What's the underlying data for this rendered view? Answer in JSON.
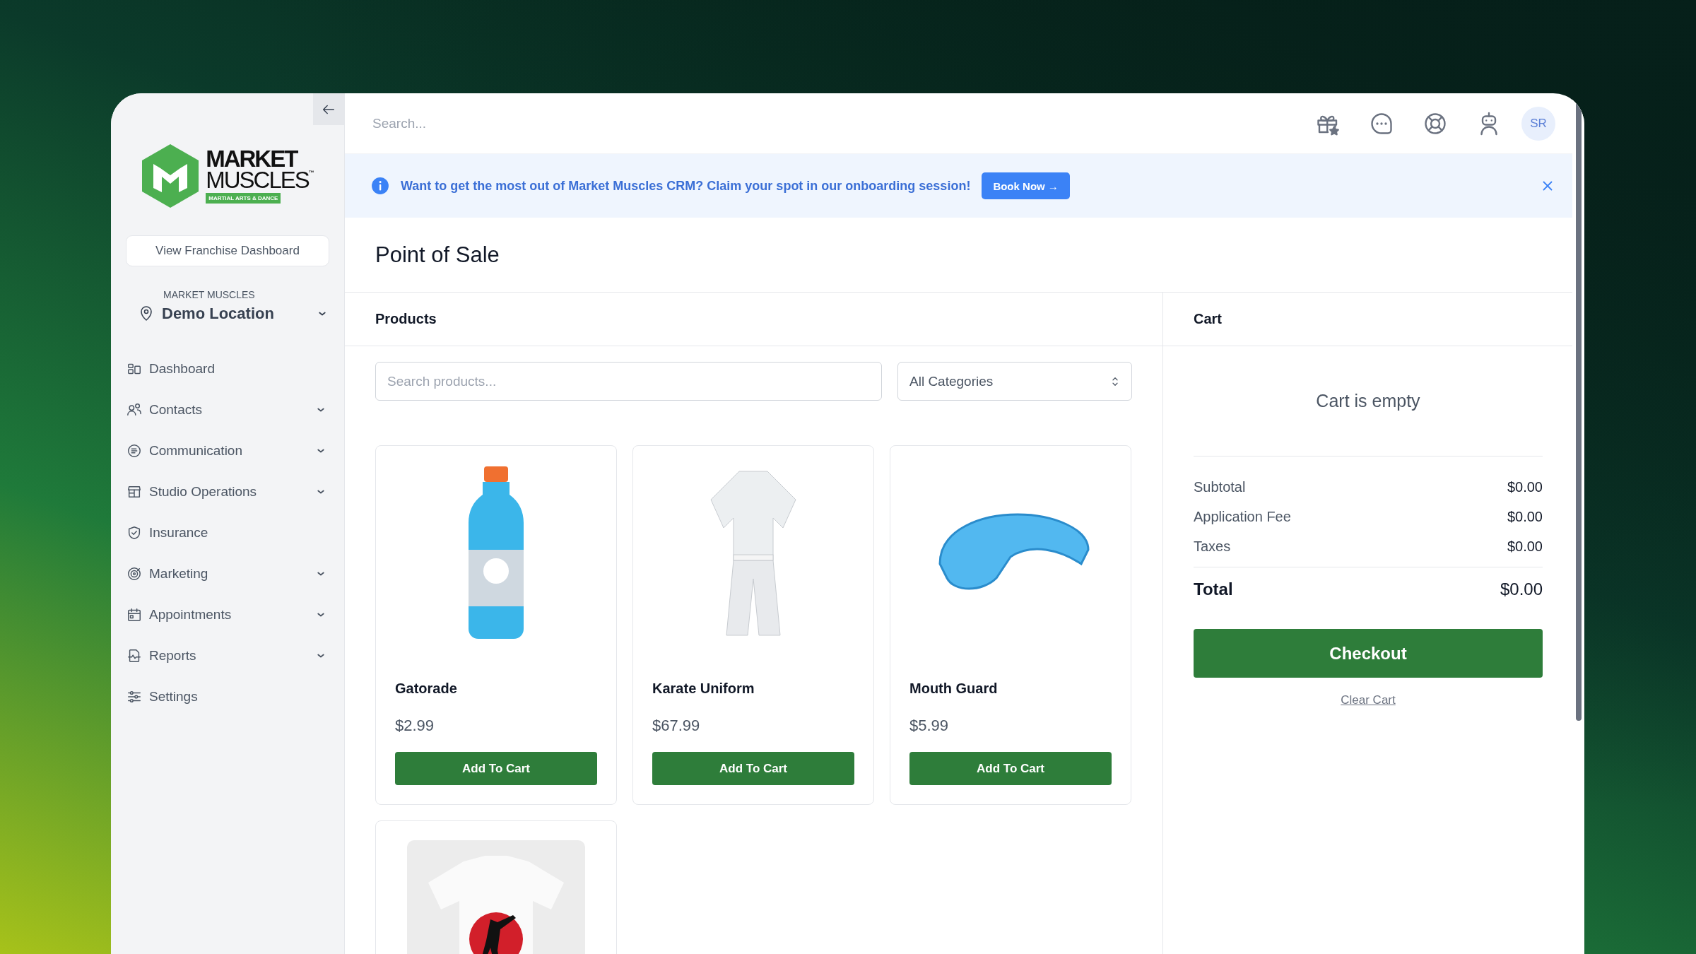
{
  "sidebar": {
    "logo": {
      "line_1": "MARKET",
      "line_2": "MUSCLES",
      "trademark": "™",
      "tagline": "MARTIAL ARTS & DANCE"
    },
    "franchise_button": "View Franchise Dashboard",
    "location": {
      "label": "MARKET MUSCLES",
      "name": "Demo Location"
    },
    "items": [
      {
        "label": "Dashboard",
        "has_submenu": false
      },
      {
        "label": "Contacts",
        "has_submenu": true
      },
      {
        "label": "Communication",
        "has_submenu": true
      },
      {
        "label": "Studio Operations",
        "has_submenu": true
      },
      {
        "label": "Insurance",
        "has_submenu": false
      },
      {
        "label": "Marketing",
        "has_submenu": true
      },
      {
        "label": "Appointments",
        "has_submenu": true
      },
      {
        "label": "Reports",
        "has_submenu": true
      },
      {
        "label": "Settings",
        "has_submenu": false
      }
    ]
  },
  "topbar": {
    "search": {
      "placeholder": "Search..."
    },
    "avatar": "SR"
  },
  "banner": {
    "message": "Want to get the most out of Market Muscles CRM? Claim your spot in our onboarding session!",
    "button": "Book Now →"
  },
  "page_title": "Point of Sale",
  "products": {
    "title": "Products",
    "search": {
      "placeholder": "Search products..."
    },
    "category_select": "All Categories",
    "items": [
      {
        "kind": "bottle",
        "name": "Gatorade",
        "price": "$2.99",
        "button": "Add To Cart"
      },
      {
        "kind": "uniform",
        "name": "Karate Uniform",
        "price": "$67.99",
        "button": "Add To Cart"
      },
      {
        "kind": "mouthguard",
        "name": "Mouth Guard",
        "price": "$5.99",
        "button": "Add To Cart"
      },
      {
        "kind": "tshirt"
      }
    ]
  },
  "cart": {
    "title": "Cart",
    "empty_message": "Cart is empty",
    "summary": [
      {
        "label": "Subtotal",
        "value": "$0.00"
      },
      {
        "label": "Application Fee",
        "value": "$0.00"
      },
      {
        "label": "Taxes",
        "value": "$0.00"
      }
    ],
    "total": {
      "label": "Total",
      "value": "$0.00"
    },
    "checkout": "Checkout",
    "clear": "Clear Cart"
  }
}
